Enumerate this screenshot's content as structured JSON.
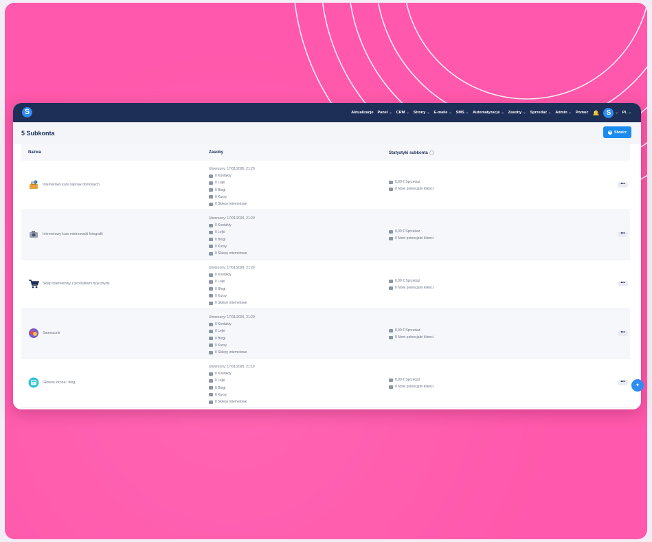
{
  "topbar": {
    "logo": "S",
    "nav": [
      {
        "label": "Aktualizacje",
        "dropdown": false
      },
      {
        "label": "Panel",
        "dropdown": true
      },
      {
        "label": "CRM",
        "dropdown": true
      },
      {
        "label": "Strony",
        "dropdown": true
      },
      {
        "label": "E-maile",
        "dropdown": true
      },
      {
        "label": "SMS",
        "dropdown": true
      },
      {
        "label": "Automatyzacje",
        "dropdown": true
      },
      {
        "label": "Zasoby",
        "dropdown": true
      },
      {
        "label": "Sprzedaż",
        "dropdown": true
      },
      {
        "label": "Admin",
        "dropdown": true
      },
      {
        "label": "Pomoc",
        "dropdown": false
      }
    ],
    "avatar": "S",
    "language": "PL"
  },
  "page": {
    "title": "5 Subkonta",
    "create_label": "Stwórz"
  },
  "table": {
    "columns": [
      "Nazwa",
      "Zasoby",
      "Statystyki subkonta"
    ],
    "rows": [
      {
        "name": "Internetowy kurs napraw domowych",
        "icon": "toolbox-icon",
        "created": "Utworzony: 17/01/2026, 21:20",
        "resources": [
          "0 Kontakty",
          "0 Lejki",
          "0 Blogi",
          "0 Kursy",
          "0 Sklepy internetowe"
        ],
        "sales": "0,00 € Sprzedaż",
        "leads": "0 Nowi potencjalni klienci"
      },
      {
        "name": "Internetowy kurs mistrzowski fotografii",
        "icon": "camera-icon",
        "created": "Utworzony: 17/01/2026, 21:20",
        "resources": [
          "0 Kontakty",
          "0 Lejki",
          "0 Blogi",
          "0 Kursy",
          "0 Sklepy internetowe"
        ],
        "sales": "0,00 € Sprzedaż",
        "leads": "0 Nowi potencjalni klienci"
      },
      {
        "name": "Sklep internetowy z produktami fizycznymi",
        "icon": "shopping-cart-icon",
        "created": "Utworzony: 17/01/2026, 21:20",
        "resources": [
          "0 Kontakty",
          "0 Lejki",
          "0 Blogi",
          "0 Kursy",
          "0 Sklepy internetowe"
        ],
        "sales": "0,00 € Sprzedaż",
        "leads": "0 Nowi potencjalni klienci"
      },
      {
        "name": "Samouczki",
        "icon": "tutorial-icon",
        "created": "Utworzony: 17/01/2026, 21:20",
        "resources": [
          "0 Kontakty",
          "0 Lejki",
          "0 Blogi",
          "0 Kursy",
          "0 Sklepy internetowe"
        ],
        "sales": "0,00 € Sprzedaż",
        "leads": "0 Nowi potencjalni klienci"
      },
      {
        "name": "Główna strona i blog",
        "icon": "blog-icon",
        "created": "Utworzony: 17/01/2026, 21:19",
        "resources": [
          "0 Kontakty",
          "0 Lejki",
          "0 Blogi",
          "0 Kursy",
          "0 Sklepy internetowe"
        ],
        "sales": "0,00 € Sprzedaż",
        "leads": "0 Nowi potencjalni klienci"
      }
    ],
    "more_label": "•••"
  },
  "colors": {
    "background": "#ff58ac",
    "topbar": "#1d2f57",
    "accent": "#1a8cf0"
  }
}
